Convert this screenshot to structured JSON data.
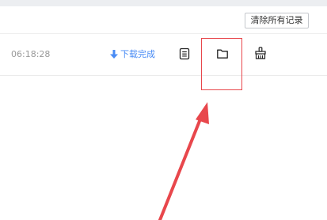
{
  "toolbar": {
    "clear_all_label": "清除所有记录"
  },
  "downloads": [
    {
      "time": "06:18:28",
      "status_icon": "download-arrow-icon",
      "status_text": "下载完成",
      "actions": [
        {
          "name": "open-file",
          "icon": "document-icon"
        },
        {
          "name": "open-folder",
          "icon": "folder-icon"
        },
        {
          "name": "clear-record",
          "icon": "broom-icon"
        }
      ]
    }
  ],
  "annotation": {
    "color": "#e8474c"
  },
  "colors": {
    "accent": "#4a8cf5",
    "annotation": "#e8474c",
    "time_text": "#999999"
  }
}
